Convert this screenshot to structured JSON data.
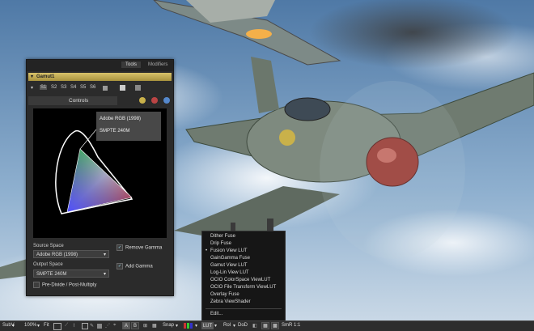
{
  "panel": {
    "tabs": {
      "tools": "Tools",
      "modifiers": "Modifiers"
    },
    "node_name": "Gamut1",
    "slots": [
      "S1",
      "S2",
      "S3",
      "S4",
      "S5",
      "S6"
    ],
    "controls_label": "Controls",
    "gamut_labels": {
      "adobe": "Adobe RGB (1998)",
      "smpte": "SMPTE 240M"
    },
    "source_space_label": "Source Space",
    "source_space_value": "Adobe RGB (1998)",
    "remove_gamma_label": "Remove Gamma",
    "output_space_label": "Output Space",
    "output_space_value": "SMPTE 240M",
    "add_gamma_label": "Add Gamma",
    "predivide_label": "Pre-Divide / Post-Multiply"
  },
  "menu": {
    "items": [
      {
        "label": "Dither Fuse",
        "checked": false
      },
      {
        "label": "Drip Fuse",
        "checked": false
      },
      {
        "label": "Fusion View LUT",
        "checked": true
      },
      {
        "label": "GainGamma Fuse",
        "checked": false
      },
      {
        "label": "Gamut View LUT",
        "checked": false
      },
      {
        "label": "Log-Lin View LUT",
        "checked": false
      },
      {
        "label": "OCIO ColorSpace ViewLUT",
        "checked": false
      },
      {
        "label": "OCIO File Transform ViewLUT",
        "checked": false
      },
      {
        "label": "Overlay Fuse",
        "checked": false
      },
      {
        "label": "Zebra ViewShader",
        "checked": false
      }
    ],
    "edit_label": "Edit..."
  },
  "toolbar": {
    "subv": "SubV",
    "zoom": "100%",
    "fit": "Fit",
    "a_btn": "A",
    "b_btn": "B",
    "snap": "Snap",
    "lut": "LUT",
    "roi": "RoI",
    "dod": "DoD",
    "smr": "SmR",
    "ratio": "1:1"
  },
  "icons": {
    "arrow_down": "▾",
    "bullet": "•",
    "check": "✓"
  }
}
